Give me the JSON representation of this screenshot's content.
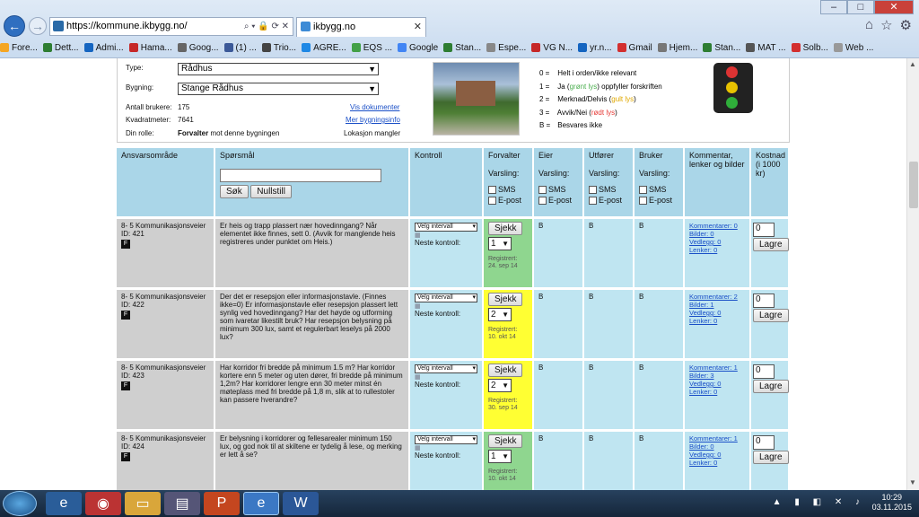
{
  "browser": {
    "url": "https://kommune.ikbygg.no/",
    "tab_title": "ikbygg.no",
    "window_controls": [
      "minimize",
      "maximize",
      "close"
    ]
  },
  "favorites": [
    "Fore...",
    "Dett...",
    "Admi...",
    "Hama...",
    "Goog...",
    "(1) ...",
    "Trio...",
    "AGRE...",
    "EQS ...",
    "Google",
    "Stan...",
    "Espe...",
    "VG N...",
    "yr.n...",
    "Gmail",
    "Hjem...",
    "Stan...",
    "MAT ...",
    "Solb...",
    "Web ..."
  ],
  "info": {
    "type_label": "Type:",
    "type_value": "Rådhus",
    "building_label": "Bygning:",
    "building_value": "Stange Rådhus",
    "users_label": "Antall brukere:",
    "users_value": "175",
    "docs_link": "Vis dokumenter",
    "sqm_label": "Kvadratmeter:",
    "sqm_value": "7641",
    "info_link": "Mer bygningsinfo",
    "role_label": "Din rolle:",
    "role_value": "Forvalter",
    "role_suffix": "mot denne bygningen",
    "location": "Lokasjon mangler"
  },
  "legend": [
    {
      "code": "0 =",
      "text": "Helt i orden/ikke relevant",
      "colored": "",
      "rest": ""
    },
    {
      "code": "1 =",
      "text": "Ja (",
      "colored": "grønt lys",
      "rest": ") oppfyller forskriften",
      "color": "#4caf50"
    },
    {
      "code": "2 =",
      "text": "Merknad/Delvis (",
      "colored": "gult lys",
      "rest": ")",
      "color": "#e0a800"
    },
    {
      "code": "3 =",
      "text": "Avvik/Nei (",
      "colored": "rødt lys",
      "rest": ")",
      "color": "#e53935"
    },
    {
      "code": "B =",
      "text": "Besvares ikke",
      "colored": "",
      "rest": ""
    }
  ],
  "headers": {
    "area": "Ansvarsområde",
    "question": "Spørsmål",
    "control": "Kontroll",
    "manager": "Forvalter",
    "owner": "Eier",
    "executor": "Utfører",
    "user": "Bruker",
    "comments": "Kommentar, lenker og bilder",
    "cost": "Kostnad (i 1000 kr)",
    "alert": "Varsling:",
    "sms": "SMS",
    "email": "E-post",
    "search_button": "Søk",
    "reset_button": "Nullstill",
    "search_placeholder": ""
  },
  "rows": [
    {
      "area": "8- 5 Kommunikasjonsveier",
      "id": "ID: 421",
      "question": "Er heis og trapp plassert nær hovedinngang? Når elementet ikke finnes, sett 0. (Avvik for manglende heis registreres under punktet om Heis.)",
      "interval": "Velg intervall",
      "next": "Neste kontroll:",
      "check": "Sjekk",
      "value": "1",
      "registered": "Registrert:",
      "date": "24. sep 14",
      "status": "green",
      "owner": "B",
      "executor": "B",
      "user": "B",
      "comments": "Kommentarer: 0",
      "images": "Bilder: 0",
      "attachments": "Vedlegg: 0",
      "links": "Lenker: 0",
      "cost": "0",
      "save": "Lagre"
    },
    {
      "area": "8- 5 Kommunikasjonsveier",
      "id": "ID: 422",
      "question": "Der det er resepsjon eller informasjonstavle. (Finnes ikke=0) Er informasjonstavle eller resepsjon plassert lett synlig ved hovedinngang? Har det høyde og utforming som ivaretar likestilt bruk? Har resepsjon belysning på minimum 300 lux, samt et regulerbart leselys på 2000 lux?",
      "interval": "Velg intervall",
      "next": "Neste kontroll:",
      "check": "Sjekk",
      "value": "2",
      "registered": "Registrert:",
      "date": "10. okt 14",
      "status": "yellow",
      "owner": "B",
      "executor": "B",
      "user": "B",
      "comments": "Kommentarer: 2",
      "images": "Bilder: 1",
      "attachments": "Vedlegg: 0",
      "links": "Lenker: 0",
      "cost": "0",
      "save": "Lagre"
    },
    {
      "area": "8- 5 Kommunikasjonsveier",
      "id": "ID: 423",
      "question": "Har korridor fri bredde på minimum 1.5 m? Har korridor kortere enn 5 meter og uten dører, fri bredde på minimum 1,2m? Har korridorer lengre enn 30 meter minst én møteplass med fri bredde på 1,8 m, slik at to rullestoler kan passere hverandre?",
      "interval": "Velg intervall",
      "next": "Neste kontroll:",
      "check": "Sjekk",
      "value": "2",
      "registered": "Registrert:",
      "date": "30. sep 14",
      "status": "yellow",
      "owner": "B",
      "executor": "B",
      "user": "B",
      "comments": "Kommentarer: 1",
      "images": "Bilder: 3",
      "attachments": "Vedlegg: 0",
      "links": "Lenker: 0",
      "cost": "0",
      "save": "Lagre"
    },
    {
      "area": "8- 5 Kommunikasjonsveier",
      "id": "ID: 424",
      "question": "Er belysning i korridorer og fellesarealer minimum 150 lux, og god nok til at skiltene er tydelig å lese, og merking er lett å se?",
      "interval": "Velg intervall",
      "next": "Neste kontroll:",
      "check": "Sjekk",
      "value": "1",
      "registered": "Registrert:",
      "date": "10. okt 14",
      "status": "green",
      "owner": "B",
      "executor": "B",
      "user": "B",
      "comments": "Kommentarer: 1",
      "images": "Bilder: 0",
      "attachments": "Vedlegg: 0",
      "links": "Lenker: 0",
      "cost": "0",
      "save": "Lagre"
    }
  ],
  "taskbar": {
    "time": "10:29",
    "date": "03.11.2015"
  }
}
